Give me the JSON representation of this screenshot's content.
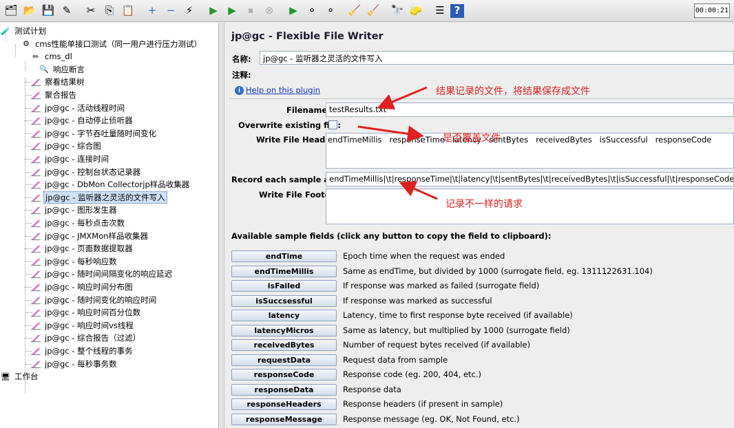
{
  "toolbar": {
    "buttons": [
      {
        "name": "templates-icon",
        "glyph": "🗂"
      },
      {
        "name": "open-icon",
        "glyph": "📂"
      },
      {
        "name": "save-icon",
        "glyph": "💾"
      },
      {
        "name": "save-as-icon",
        "glyph": "✎"
      },
      {
        "name": "cut-icon",
        "glyph": "✂"
      },
      {
        "name": "copy-icon",
        "glyph": "⎘"
      },
      {
        "name": "paste-icon",
        "glyph": "📋"
      },
      {
        "name": "expand-icon",
        "glyph": "+"
      },
      {
        "name": "collapse-icon",
        "glyph": "−"
      },
      {
        "name": "toggle-icon",
        "glyph": "⚡"
      },
      {
        "name": "start-icon",
        "glyph": "▶"
      },
      {
        "name": "start-no-pause-icon",
        "glyph": "▶"
      },
      {
        "name": "stop-icon",
        "glyph": "⏹"
      },
      {
        "name": "shutdown-icon",
        "glyph": "⊗"
      },
      {
        "name": "remote-start-icon",
        "glyph": "▶"
      },
      {
        "name": "remote-stop-icon",
        "glyph": "⚬"
      },
      {
        "name": "remote-exit-icon",
        "glyph": "⚬"
      },
      {
        "name": "clear-icon",
        "glyph": "🧹"
      },
      {
        "name": "clear-all-icon",
        "glyph": "🧹"
      },
      {
        "name": "search-icon",
        "glyph": "🔭"
      },
      {
        "name": "reset-search-icon",
        "glyph": "🧽"
      },
      {
        "name": "function-helper-icon",
        "glyph": "☰"
      },
      {
        "name": "help-icon",
        "glyph": "?"
      }
    ],
    "timer": "00:00:21"
  },
  "tree": [
    {
      "label": "测试计划",
      "icon": "test-plan-icon",
      "level": 0
    },
    {
      "label": "cms性能单接口测试（同一用户进行压力测试）",
      "icon": "thread-group-icon",
      "level": 1
    },
    {
      "label": "cms_dl",
      "icon": "sampler-icon",
      "level": 2
    },
    {
      "label": "响应断言",
      "icon": "assertion-icon",
      "level": 3
    },
    {
      "label": "察看结果树",
      "icon": "listener-icon",
      "level": 2
    },
    {
      "label": "聚合报告",
      "icon": "listener-icon",
      "level": 2
    },
    {
      "label": "jp@gc - 活动线程时间",
      "icon": "listener-icon",
      "level": 2
    },
    {
      "label": "jp@gc - 自动停止侦听器",
      "icon": "listener-icon",
      "level": 2
    },
    {
      "label": "jp@gc - 字节吞吐量随时间变化",
      "icon": "listener-icon",
      "level": 2
    },
    {
      "label": "jp@gc - 综合图",
      "icon": "listener-icon",
      "level": 2
    },
    {
      "label": "jp@gc - 连接时间",
      "icon": "listener-icon",
      "level": 2
    },
    {
      "label": "jp@gc - 控制台状态记录器",
      "icon": "listener-icon",
      "level": 2
    },
    {
      "label": "jp@gc - DbMon Collectorjp样品收集器",
      "icon": "listener-icon",
      "level": 2
    },
    {
      "label": "jp@gc - 监听器之灵活的文件写入",
      "icon": "listener-icon",
      "level": 2,
      "selected": true
    },
    {
      "label": "jp@gc - 图形发生器",
      "icon": "listener-icon",
      "level": 2
    },
    {
      "label": "jp@gc - 每秒点击次数",
      "icon": "listener-icon",
      "level": 2
    },
    {
      "label": "jp@gc - JMXMon样品收集器",
      "icon": "listener-icon",
      "level": 2
    },
    {
      "label": "jp@gc - 页面数据提取器",
      "icon": "listener-icon",
      "level": 2
    },
    {
      "label": "jp@gc - 每秒响应数",
      "icon": "listener-icon",
      "level": 2
    },
    {
      "label": "jp@gc - 随时间间隔变化的响应延迟",
      "icon": "listener-icon",
      "level": 2
    },
    {
      "label": "jp@gc - 响应时间分布图",
      "icon": "listener-icon",
      "level": 2
    },
    {
      "label": "jp@gc - 随时间变化的响应时间",
      "icon": "listener-icon",
      "level": 2
    },
    {
      "label": "jp@gc - 响应时间百分位数",
      "icon": "listener-icon",
      "level": 2
    },
    {
      "label": "jp@gc - 响应时间vs线程",
      "icon": "listener-icon",
      "level": 2
    },
    {
      "label": "jp@gc - 综合报告（过滤）",
      "icon": "listener-icon",
      "level": 2
    },
    {
      "label": "jp@gc - 整个线程的事务",
      "icon": "listener-icon",
      "level": 2
    },
    {
      "label": "jp@gc - 每秒事务数",
      "icon": "listener-icon",
      "level": 2
    },
    {
      "label": "工作台",
      "icon": "workbench-icon",
      "level": 0
    }
  ],
  "panel": {
    "title": "jp@gc - Flexible File Writer",
    "name_label": "名称:",
    "name_value": "jp@gc - 监听器之灵活的文件写入",
    "comment_label": "注释:",
    "help_link": "Help on this plugin",
    "filename_label": "Filename:",
    "filename_value": "testResults.txt",
    "overwrite_label": "Overwrite existing file:",
    "header_label": "Write File Header:",
    "header_value": "endTimeMillis   responseTime   latency   sentBytes   receivedBytes   isSuccessful   responseCode",
    "record_label": "Record each sample as:",
    "record_value": "endTimeMillis|\\t|responseTime|\\t|latency|\\t|sentBytes|\\t|receivedBytes|\\t|isSuccessful|\\t|responseCode|\\r\\n",
    "footer_label": "Write File Footer:",
    "available_label": "Available sample fields (click any button to copy the field to clipboard):",
    "fields": [
      {
        "name": "endTime",
        "desc": "Epoch time when the request was ended"
      },
      {
        "name": "endTimeMillis",
        "desc": "Same as endTime, but divided by 1000 (surrogate field, eg. 1311122631.104)"
      },
      {
        "name": "isFailed",
        "desc": "If response was marked as failed (surrogate field)"
      },
      {
        "name": "isSuccsessful",
        "desc": "If response was marked as successful"
      },
      {
        "name": "latency",
        "desc": "Latency, time to first response byte received (if available)"
      },
      {
        "name": "latencyMicros",
        "desc": "Same as latency, but multiplied by 1000 (surrogate field)"
      },
      {
        "name": "receivedBytes",
        "desc": "Number of request bytes received (if available)"
      },
      {
        "name": "requestData",
        "desc": "Request data from sample"
      },
      {
        "name": "responseCode",
        "desc": "Response code (eg. 200, 404, etc.)"
      },
      {
        "name": "responseData",
        "desc": "Response data"
      },
      {
        "name": "responseHeaders",
        "desc": "Response headers (if present in sample)"
      },
      {
        "name": "responseMessage",
        "desc": "Response message (eg. OK, Not Found, etc.)"
      }
    ]
  },
  "annotations": {
    "result_file": "结果记录的文件，将结果保存成文件",
    "overwrite": "是否覆盖文件",
    "record": "记录不一样的请求"
  },
  "colors": {
    "annotation": "#e02020",
    "selection": "#cfe1f5",
    "link": "#1a37c4"
  }
}
